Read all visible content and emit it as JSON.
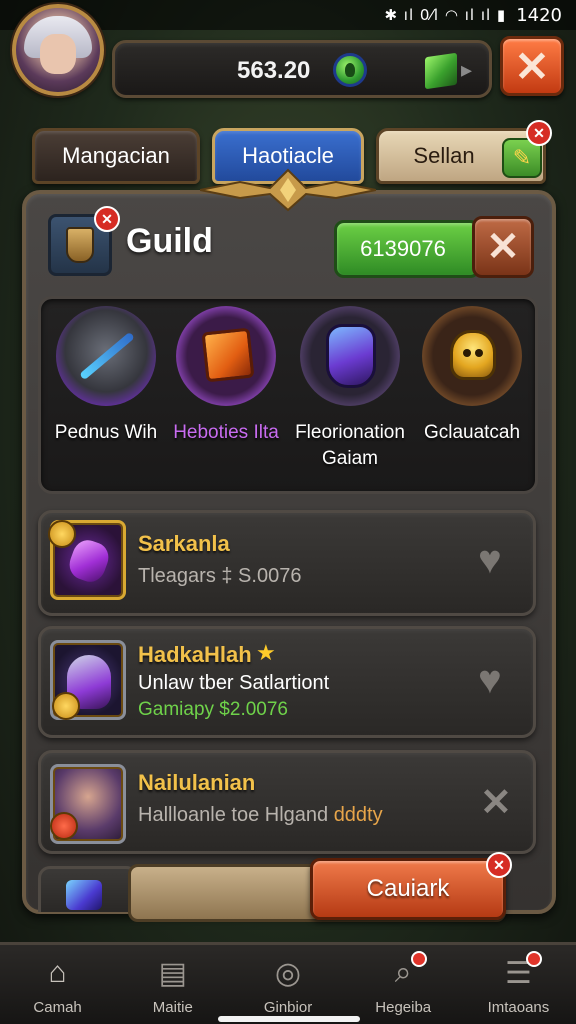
{
  "status_bar": {
    "signal_glyphs": "✱ ıl 0⁄l ◠ ıl ıl ▮",
    "time": "1420"
  },
  "top_bar": {
    "currency_value": "563.20",
    "close_label": "✕"
  },
  "tabs": [
    {
      "label": "Mangacian",
      "state": "inactive"
    },
    {
      "label": "Haotiacle",
      "state": "active"
    },
    {
      "label": "Sellan",
      "state": "inactive"
    }
  ],
  "guild": {
    "title": "Guild",
    "currency": "6139076",
    "close_label": "✕"
  },
  "items": [
    {
      "label": "Pednus Wih",
      "icon": "armored-sword-icon"
    },
    {
      "label": "Heboties Ilta",
      "icon": "orange-cube-icon"
    },
    {
      "label": "Fleorionation Gaiam",
      "icon": "purple-armor-icon"
    },
    {
      "label": "Gclauatcah",
      "icon": "golden-golem-icon"
    }
  ],
  "cards": [
    {
      "title": "Sarkanla",
      "subtitle": "Tleagars ‡ S.0076",
      "action_icon": "heart-icon"
    },
    {
      "title": "HadkaHlah",
      "line2": "Unlaw tber Satlartiont",
      "line3": "Gamiapy $2.0076",
      "action_icon": "heart-icon"
    },
    {
      "title": "Nailulanian",
      "subtitle_main": "Hallloanle toe Hlgand ",
      "subtitle_highlight": "dddty",
      "action_icon": "close-icon"
    }
  ],
  "action_button": {
    "label": "Cauiark"
  },
  "bottom_nav": [
    {
      "label": "Camah",
      "icon": "home-icon",
      "active": true,
      "alert": false
    },
    {
      "label": "Maitie",
      "icon": "scroll-icon",
      "active": false,
      "alert": false
    },
    {
      "label": "Ginbior",
      "icon": "compass-icon",
      "active": false,
      "alert": false
    },
    {
      "label": "Hegeiba",
      "icon": "magnifier-icon",
      "active": false,
      "alert": true
    },
    {
      "label": "Imtaoans",
      "icon": "menu-icon",
      "active": false,
      "alert": true
    }
  ],
  "colors": {
    "accent_gold": "#f2c14a",
    "accent_green": "#6fd24a",
    "accent_purple": "#c86cf0",
    "accent_orange": "#e7a54a",
    "close_red": "#c23a12"
  }
}
